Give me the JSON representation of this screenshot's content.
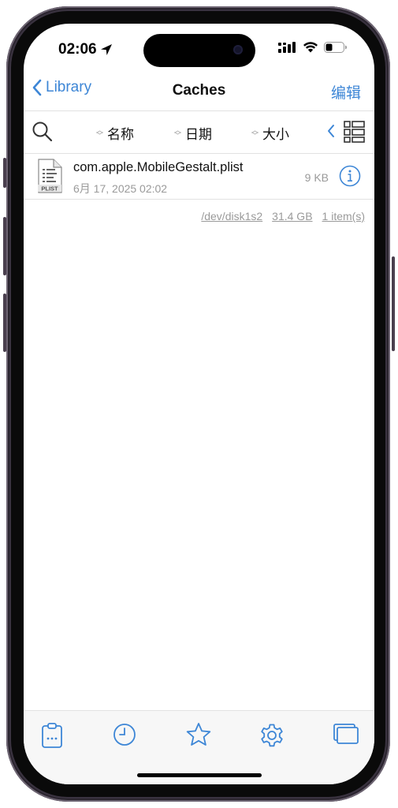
{
  "status_bar": {
    "time": "02:06",
    "icons": [
      "location-arrow-icon",
      "cellular-signal-icon",
      "wifi-icon",
      "battery-icon"
    ]
  },
  "nav": {
    "back_label": "Library",
    "title": "Caches",
    "edit_label": "编辑"
  },
  "sort_bar": {
    "columns": [
      {
        "label": "名称"
      },
      {
        "label": "日期"
      },
      {
        "label": "大小"
      }
    ]
  },
  "files": [
    {
      "name": "com.apple.MobileGestalt.plist",
      "date": "6月 17, 2025 02:02",
      "size": "9 KB",
      "icon_label": "PLIST"
    }
  ],
  "footer": {
    "device": "/dev/disk1s2",
    "free_space": "31.4 GB",
    "item_count": "1 item(s)"
  },
  "tab_bar": {
    "tabs": [
      "clipboard-icon",
      "clock-icon",
      "star-icon",
      "gear-icon",
      "windows-icon"
    ]
  },
  "colors": {
    "accent": "#3d86d6",
    "secondary_text": "#9a9a9a",
    "tab_icon": "#3d86d6"
  }
}
